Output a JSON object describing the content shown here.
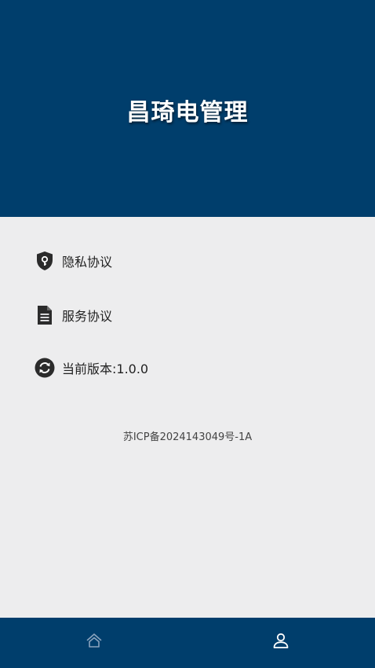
{
  "header": {
    "title": "昌琦电管理"
  },
  "menu": [
    {
      "label": "隐私协议",
      "icon": "shield-key-icon"
    },
    {
      "label": "服务协议",
      "icon": "document-icon"
    },
    {
      "label": "当前版本:1.0.0",
      "icon": "refresh-icon"
    }
  ],
  "footer": {
    "icp": "苏ICP备2024143049号-1A"
  },
  "tabbar": {
    "tabs": [
      {
        "icon": "home-icon",
        "active": false
      },
      {
        "icon": "user-icon",
        "active": true
      }
    ]
  },
  "colors": {
    "primary": "#003e6c",
    "background": "#ededee",
    "tab_inactive": "#8aa3bd",
    "tab_active": "#ffffff"
  }
}
